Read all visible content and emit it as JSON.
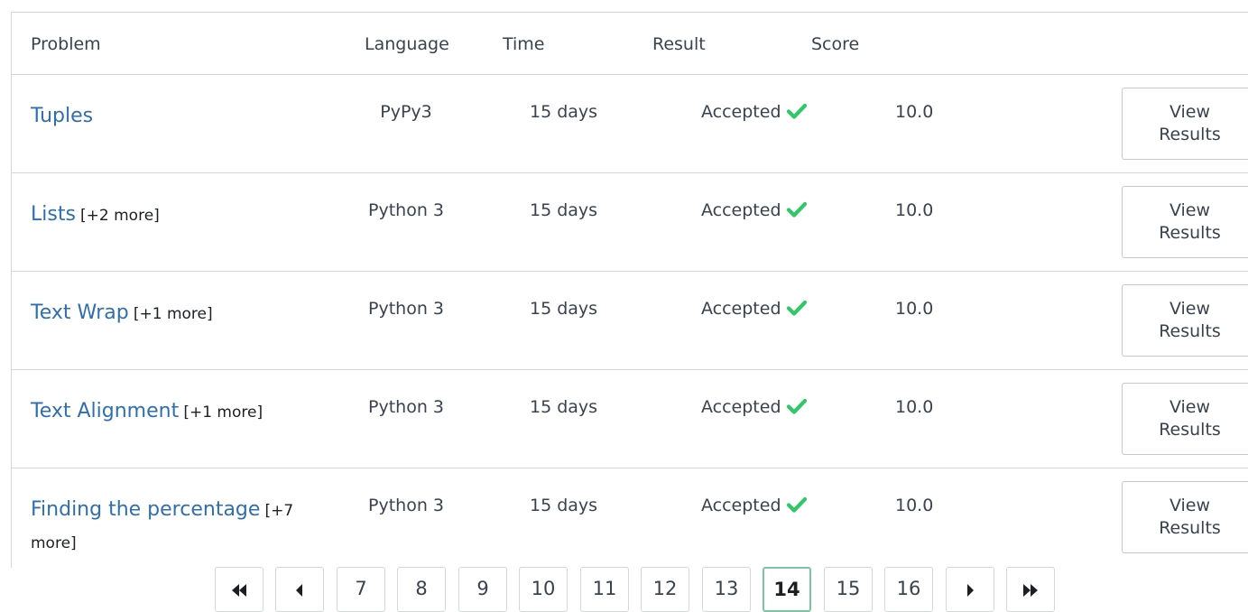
{
  "table": {
    "headers": {
      "problem": "Problem",
      "language": "Language",
      "time": "Time",
      "result": "Result",
      "score": "Score"
    },
    "rows": [
      {
        "problem": "Tuples",
        "more": "",
        "language": "PyPy3",
        "time": "15 days",
        "result": "Accepted",
        "score": "10.0",
        "button_line1": "View",
        "button_line2": "Results"
      },
      {
        "problem": "Lists",
        "more": "[+2 more]",
        "language": "Python 3",
        "time": "15 days",
        "result": "Accepted",
        "score": "10.0",
        "button_line1": "View",
        "button_line2": "Results"
      },
      {
        "problem": "Text Wrap",
        "more": "[+1 more]",
        "language": "Python 3",
        "time": "15 days",
        "result": "Accepted",
        "score": "10.0",
        "button_line1": "View",
        "button_line2": "Results"
      },
      {
        "problem": "Text Alignment",
        "more": "[+1 more]",
        "language": "Python 3",
        "time": "15 days",
        "result": "Accepted",
        "score": "10.0",
        "button_line1": "View",
        "button_line2": "Results"
      },
      {
        "problem": "Finding the percentage",
        "more": "[+7 more]",
        "language": "Python 3",
        "time": "15 days",
        "result": "Accepted",
        "score": "10.0",
        "button_line1": "View",
        "button_line2": "Results"
      }
    ]
  },
  "pagination": {
    "pages": [
      "7",
      "8",
      "9",
      "10",
      "11",
      "12",
      "13",
      "14",
      "15",
      "16"
    ],
    "current": "14"
  },
  "colors": {
    "link": "#2f6fb0",
    "accepted_check": "#2ec866",
    "active_page_border": "#7fc4a2"
  },
  "icons": {
    "first": "double-chevron-left-icon",
    "prev": "chevron-left-icon",
    "next": "chevron-right-icon",
    "last": "double-chevron-right-icon",
    "accepted": "checkmark-icon"
  }
}
